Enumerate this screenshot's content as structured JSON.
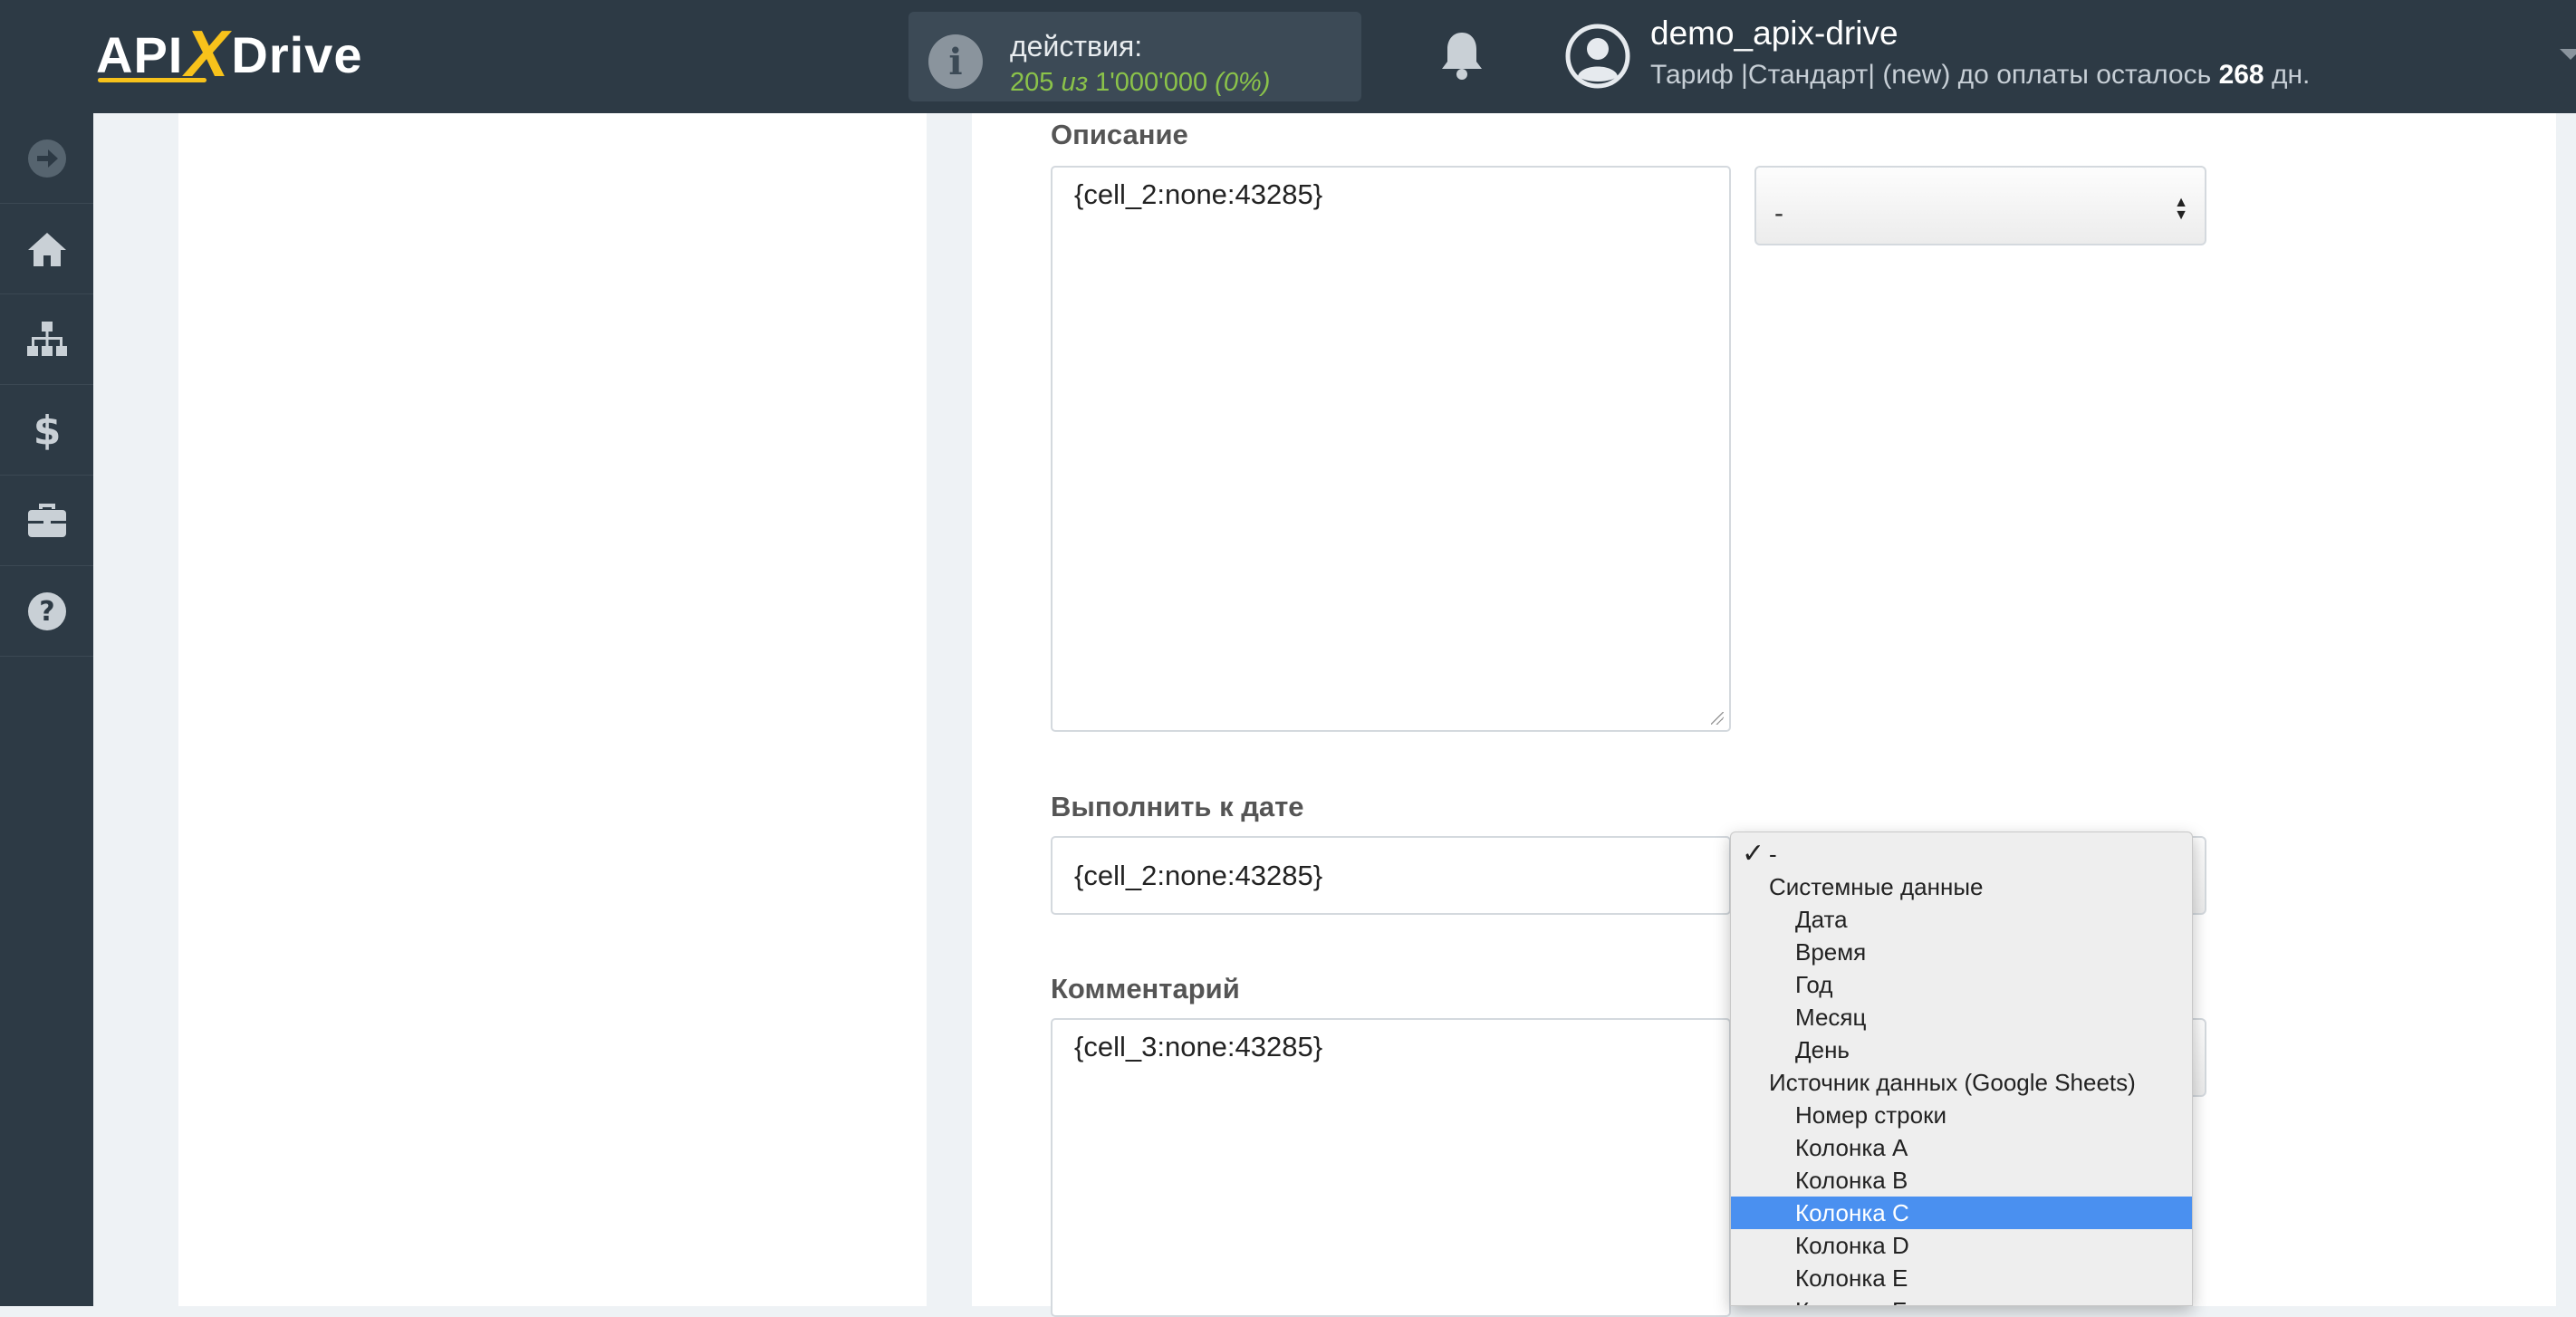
{
  "header": {
    "logo_api": "API",
    "logo_x": "X",
    "logo_drive": "Drive",
    "actions_label": "действия:",
    "actions_used": "205",
    "actions_of": "из",
    "actions_total": "1'000'000",
    "actions_percent": "(0%)",
    "username": "demo_apix-drive",
    "tariff_text": "Тариф |Стандарт| (new) до оплаты осталось",
    "tariff_days": "268",
    "tariff_days_unit": "дн."
  },
  "sidebar": {
    "items": [
      {
        "icon": "arrow-right-circle-icon"
      },
      {
        "icon": "home-icon"
      },
      {
        "icon": "sitemap-icon"
      },
      {
        "icon": "dollar-icon"
      },
      {
        "icon": "briefcase-icon"
      },
      {
        "icon": "help-circle-icon"
      }
    ]
  },
  "form": {
    "description_label": "Описание",
    "description_value": "{cell_2:none:43285}",
    "description_select_value": "-",
    "due_date_label": "Выполнить к дате",
    "due_date_value": "{cell_2:none:43285}",
    "comment_label": "Комментарий",
    "comment_value": "{cell_3:none:43285}"
  },
  "dropdown": {
    "checked": "✓",
    "items": [
      {
        "label": "-",
        "kind": "option"
      },
      {
        "label": "Системные данные",
        "kind": "group"
      },
      {
        "label": "Дата",
        "kind": "child"
      },
      {
        "label": "Время",
        "kind": "child"
      },
      {
        "label": "Год",
        "kind": "child"
      },
      {
        "label": "Месяц",
        "kind": "child"
      },
      {
        "label": "День",
        "kind": "child"
      },
      {
        "label": "Источник данных (Google Sheets)",
        "kind": "group"
      },
      {
        "label": "Номер строки",
        "kind": "child"
      },
      {
        "label": "Колонка A",
        "kind": "child"
      },
      {
        "label": "Колонка B",
        "kind": "child"
      },
      {
        "label": "Колонка C",
        "kind": "child",
        "selected": true
      },
      {
        "label": "Колонка D",
        "kind": "child"
      },
      {
        "label": "Колонка E",
        "kind": "child"
      },
      {
        "label": "Колонка F",
        "kind": "child"
      }
    ]
  },
  "colors": {
    "topbar": "#2d3a45",
    "accent_yellow": "#f7c21b",
    "actions_green": "#8bc34a",
    "selected_blue": "#4a90f0"
  }
}
